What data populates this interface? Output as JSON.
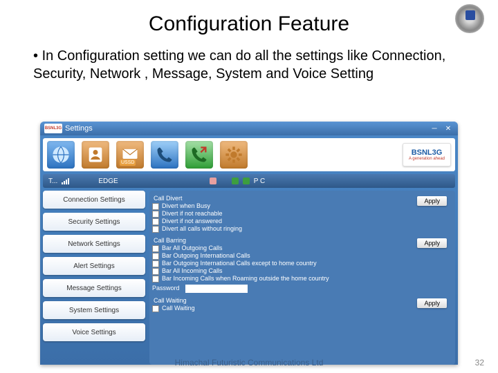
{
  "slide": {
    "title": "Configuration Feature",
    "bullet": "In Configuration setting we can do all the settings like Connection, Security, Network , Message, System and Voice Setting",
    "company": "Himachal Futuristic Communications Ltd",
    "page_number": "32"
  },
  "titlebar": {
    "brand_small": "BSNL3G",
    "window_title": "Settings"
  },
  "toolbar": {
    "icons": [
      "globe-icon",
      "phonebook-icon",
      "message-icon",
      "phone-icon",
      "calls-icon",
      "settings-icon"
    ],
    "msg_badge": "USSD",
    "brand_big_top": "BSNL3G",
    "brand_big_bottom": "A generation ahead"
  },
  "statusbar": {
    "signal_label": "T...",
    "network_type": "EDGE",
    "pc_label": "P C"
  },
  "sidebar": {
    "items": [
      {
        "label": "Connection Settings"
      },
      {
        "label": "Security Settings"
      },
      {
        "label": "Network Settings"
      },
      {
        "label": "Alert Settings"
      },
      {
        "label": "Message Settings"
      },
      {
        "label": "System Settings"
      },
      {
        "label": "Voice Settings"
      }
    ]
  },
  "panel": {
    "divert": {
      "title": "Call Divert",
      "options": [
        "Divert when Busy",
        "Divert if not reachable",
        "Divert if not answered",
        "Divert all calls without ringing"
      ],
      "apply": "Apply"
    },
    "barring": {
      "title": "Call Barring",
      "options": [
        "Bar All Outgoing Calls",
        "Bar Outgoing International Calls",
        "Bar Outgoing International Calls except to home country",
        "Bar All Incoming Calls",
        "Bar Incoming Calls when Roaming outside the home country"
      ],
      "apply": "Apply",
      "password_label": "Password"
    },
    "waiting": {
      "title": "Call Waiting",
      "option": "Call Waiting",
      "apply": "Apply"
    }
  }
}
